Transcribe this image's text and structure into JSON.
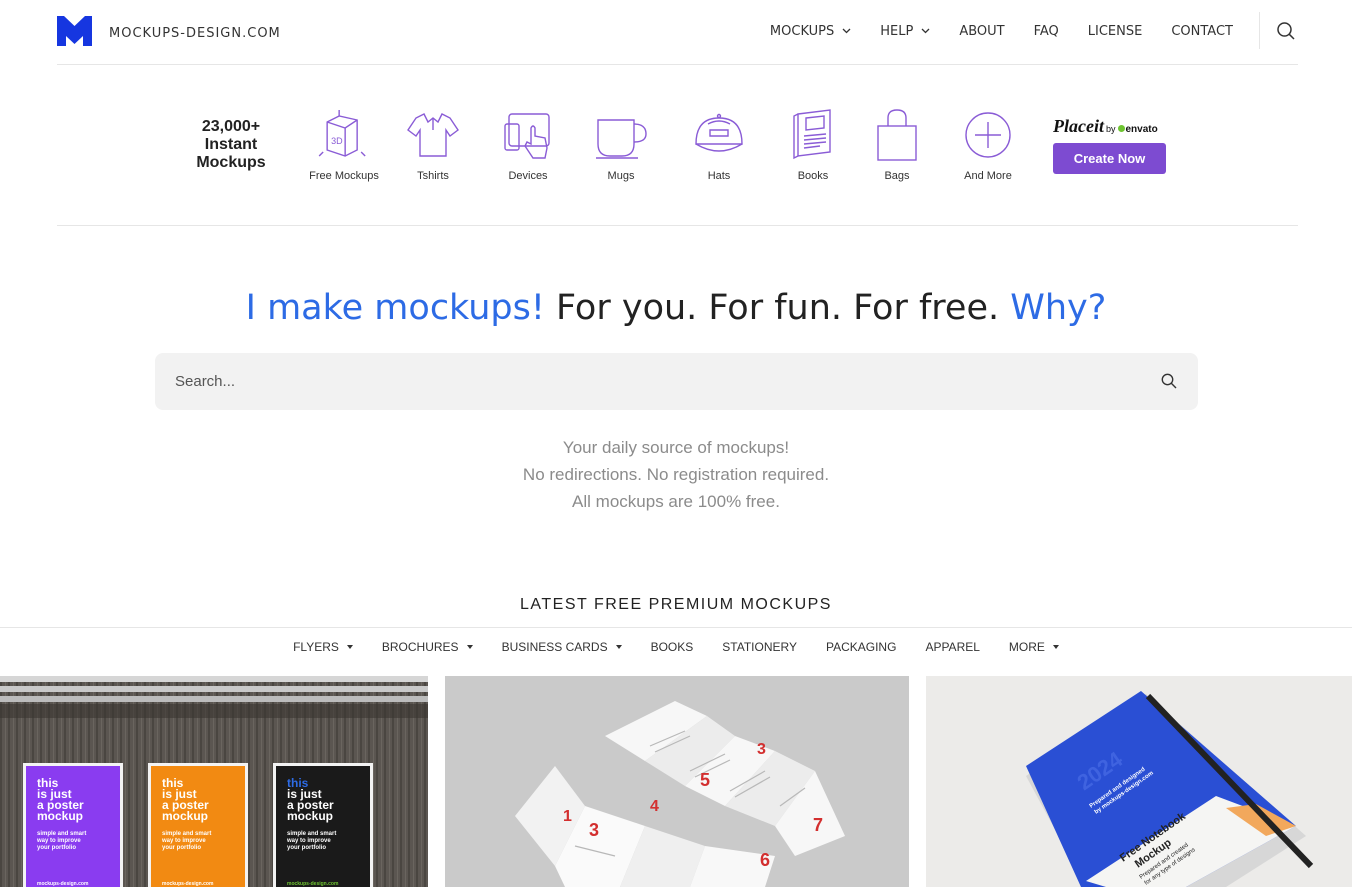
{
  "header": {
    "logo_text": "MOCKUPS-DESIGN.COM",
    "brand_color": "#1636e0",
    "nav": [
      {
        "label": "MOCKUPS",
        "dropdown": true
      },
      {
        "label": "HELP",
        "dropdown": true
      },
      {
        "label": "ABOUT",
        "dropdown": false
      },
      {
        "label": "FAQ",
        "dropdown": false
      },
      {
        "label": "LICENSE",
        "dropdown": false
      },
      {
        "label": "CONTACT",
        "dropdown": false
      }
    ]
  },
  "categories": {
    "count_lines": [
      "23,000+",
      "Instant",
      "Mockups"
    ],
    "icon_color": "#8a5cd6",
    "items": [
      {
        "label": "Free Mockups",
        "icon": "3d-box-icon"
      },
      {
        "label": "Tshirts",
        "icon": "tshirt-icon"
      },
      {
        "label": "Devices",
        "icon": "devices-icon"
      },
      {
        "label": "Mugs",
        "icon": "mug-icon"
      },
      {
        "label": "Hats",
        "icon": "hat-icon"
      },
      {
        "label": "Books",
        "icon": "book-icon"
      },
      {
        "label": "Bags",
        "icon": "bag-icon"
      },
      {
        "label": "And More",
        "icon": "plus-icon"
      }
    ],
    "placeit": {
      "brand": "Placeit",
      "by": "by",
      "partner": "envato",
      "button": "Create Now",
      "button_color": "#7d4bd1"
    }
  },
  "hero": {
    "part1": "I make mockups!",
    "part2": " For you. For fun. For free. ",
    "part3": "Why?",
    "accent_color": "#2d6be5"
  },
  "search": {
    "placeholder": "Search..."
  },
  "tagline": [
    "Your daily source of mockups!",
    "No redirections. No registration required.",
    "All mockups are 100% free."
  ],
  "latest": {
    "heading": "LATEST FREE PREMIUM MOCKUPS",
    "filters": [
      {
        "label": "FLYERS",
        "dropdown": true
      },
      {
        "label": "BROCHURES",
        "dropdown": true
      },
      {
        "label": "BUSINESS CARDS",
        "dropdown": true
      },
      {
        "label": "BOOKS",
        "dropdown": false
      },
      {
        "label": "STATIONERY",
        "dropdown": false
      },
      {
        "label": "PACKAGING",
        "dropdown": false
      },
      {
        "label": "APPAREL",
        "dropdown": false
      },
      {
        "label": "MORE",
        "dropdown": true
      }
    ]
  },
  "cards": {
    "poster": {
      "headline": [
        "this",
        "is just",
        "a poster",
        "mockup"
      ],
      "sub": [
        "simple and smart",
        "way to improve",
        "your portfolio"
      ],
      "footer": "mockups-design.com",
      "colors": [
        "#8a3cf0",
        "#f28a12",
        "#1a1a1a"
      ]
    },
    "brochure": {
      "numbers": [
        "1",
        "3",
        "4",
        "5",
        "3",
        "6",
        "7"
      ]
    },
    "notebook": {
      "year": "2024",
      "credit": [
        "Prepared and designed",
        "by mockups-design.com"
      ],
      "title": [
        "Free Notebook",
        "Mockup"
      ],
      "subtitle": [
        "Prepared and created",
        "for any type of designs"
      ]
    }
  }
}
